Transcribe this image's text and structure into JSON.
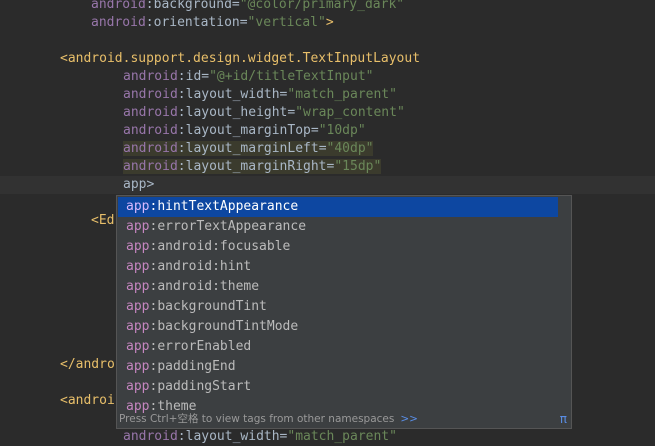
{
  "editor": {
    "lines": {
      "l1": {
        "attr": "android",
        "name": "background",
        "value": "\"@color/primary_dark\""
      },
      "l2": {
        "attr": "android",
        "name": "orientation",
        "value": "\"vertical\"",
        "tail": ">"
      },
      "l3": {
        "tag_open": "<",
        "tag": "android.support.design.widget.TextInputLayout"
      },
      "l4": {
        "attr": "android",
        "name": "id",
        "value": "\"@+id/titleTextInput\""
      },
      "l5": {
        "attr": "android",
        "name": "layout_width",
        "value": "\"match_parent\""
      },
      "l6": {
        "attr": "android",
        "name": "layout_height",
        "value": "\"wrap_content\""
      },
      "l7": {
        "attr": "android",
        "name": "layout_marginTop",
        "value": "\"10dp\""
      },
      "l8": {
        "attr": "android",
        "name": "layout_marginLeft",
        "value": "\"40dp\""
      },
      "l9": {
        "attr": "android",
        "name": "layout_marginRight",
        "value": "\"15dp\""
      },
      "l10": {
        "typed": "app>"
      },
      "l11": {
        "text": "<Ed"
      },
      "l12": {
        "text": "</andro"
      },
      "l13": {
        "text": "<androi"
      },
      "l14": {
        "attr": "android",
        "name": "layout_width",
        "value": "\"match_parent\""
      }
    }
  },
  "autocomplete": {
    "prefix": "app",
    "items": [
      {
        "name": "hintTextAppearance",
        "selected": true
      },
      {
        "name": "errorTextAppearance"
      },
      {
        "name": "android:focusable"
      },
      {
        "name": "android:hint"
      },
      {
        "name": "android:theme"
      },
      {
        "name": "backgroundTint"
      },
      {
        "name": "backgroundTintMode"
      },
      {
        "name": "errorEnabled"
      },
      {
        "name": "paddingEnd"
      },
      {
        "name": "paddingStart"
      },
      {
        "name": "theme"
      }
    ],
    "footer_text": "Press Ctrl+空格 to view tags from other namespaces",
    "footer_link": ">>",
    "pi_symbol": "π"
  },
  "colors": {
    "editor_bg": "#2b2b2b",
    "attribute": "#9876aa",
    "string_value": "#6a8759",
    "tag": "#e8bf6a",
    "selection": "#0d47a1",
    "popup_bg": "#3c3f41"
  }
}
